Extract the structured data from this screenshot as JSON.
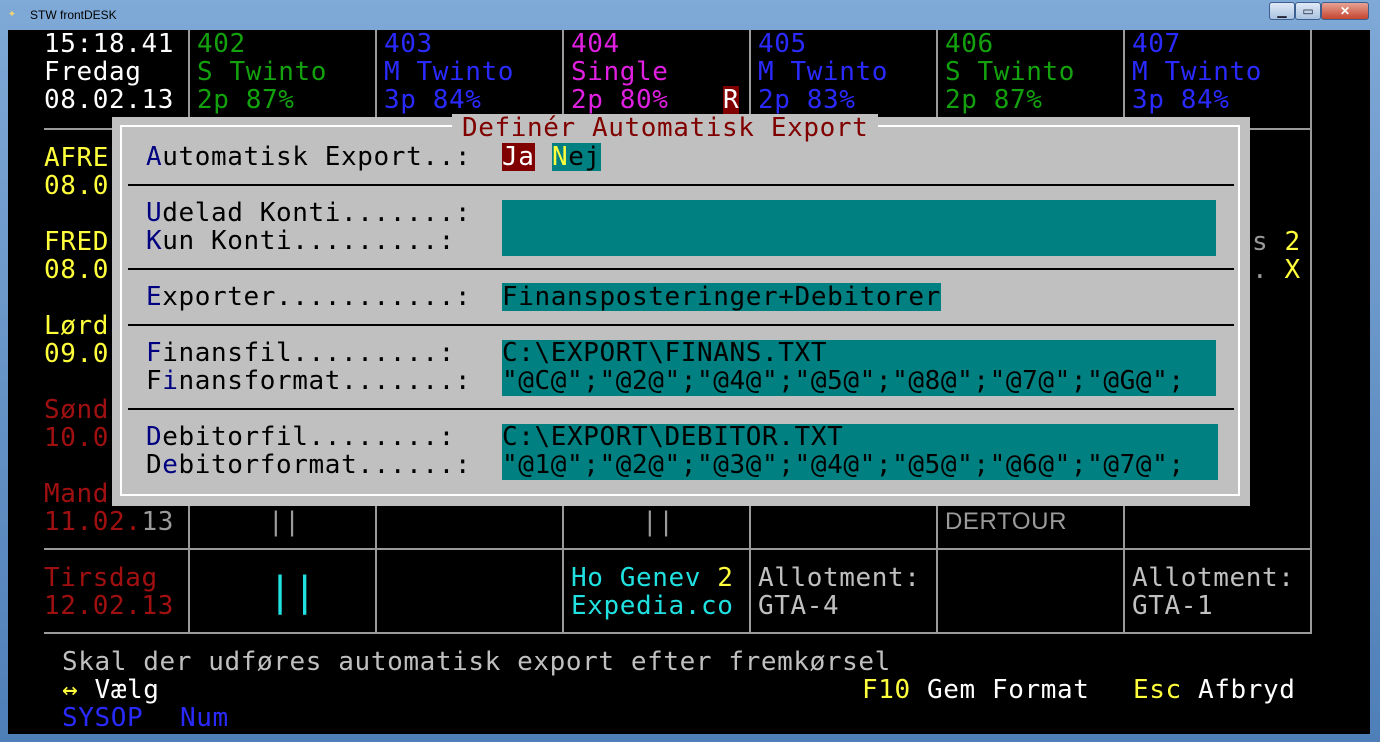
{
  "window": {
    "title": "STW frontDESK",
    "minimize": "▁",
    "restore": "▭",
    "close": "✕"
  },
  "clock": {
    "time": "15:18.41",
    "day": "Fredag",
    "date": "08.02.13"
  },
  "rooms": [
    {
      "number": "402",
      "type": "S Twinto",
      "stats": "2p 87%",
      "color": "#13a10e"
    },
    {
      "number": "403",
      "type": "M Twinto",
      "stats": "3p 84%",
      "color": "#2a2aff"
    },
    {
      "number": "404",
      "type": "Single",
      "stats": "2p 80%",
      "color": "#e020e0",
      "flag": "R"
    },
    {
      "number": "405",
      "type": "M Twinto",
      "stats": "2p 83%",
      "color": "#2a2aff"
    },
    {
      "number": "406",
      "type": "S Twinto",
      "stats": "2p 87%",
      "color": "#13a10e"
    },
    {
      "number": "407",
      "type": "M Twinto",
      "stats": "3p 84%",
      "color": "#2a2aff"
    }
  ],
  "days": [
    {
      "name": "AFRE",
      "date": "08.0"
    },
    {
      "name": "FRED",
      "date": "08.0"
    },
    {
      "name": "Lørd",
      "date": "09.0"
    },
    {
      "name": "Sønd",
      "date": "10.0"
    },
    {
      "name": "Mand",
      "date": "11.02.",
      "date_suffix": "13"
    },
    {
      "name": "Tirsdag",
      "date": "12.02.13"
    }
  ],
  "grid_fragments": {
    "right_row2_a": "s 2",
    "right_row2_b": ". X",
    "dertour": "DERTOUR",
    "bars_a": "||",
    "bars_b": "||",
    "bars_c": "||",
    "ho_genev": "Ho Genev",
    "ho_genev_n": "2",
    "expedia": "Expedia.co",
    "allot1_label": "Allotment:",
    "allot1_value": "GTA-4",
    "allot2_label": "Allotment:",
    "allot2_value": "GTA-1"
  },
  "dialog": {
    "title": "Definér Automatisk Export",
    "auto_export": {
      "hotkey": "A",
      "label": "utomatisk Export..: ",
      "opt_yes_key": "J",
      "opt_yes_rest": "a",
      "opt_no_key": "N",
      "opt_no_rest": "ej"
    },
    "udelad": {
      "hotkey": "U",
      "label": "delad Konti.......: ",
      "value": ""
    },
    "kun": {
      "hotkey": "K",
      "label": "un Konti.........: ",
      "value": ""
    },
    "exporter": {
      "hotkey": "E",
      "label": "xporter...........: ",
      "value": "Finansposteringer+Debitorer"
    },
    "finansfil": {
      "hotkey": "F",
      "label": "inansfil.........: ",
      "value": "C:\\EXPORT\\FINANS.TXT"
    },
    "finansformat": {
      "prefix": "F",
      "hotkey": "i",
      "label": "nansformat.......: ",
      "value": "\"@C@\";\"@2@\";\"@4@\";\"@5@\";\"@8@\";\"@7@\";\"@G@\";"
    },
    "debitorfil": {
      "hotkey": "D",
      "label": "ebitorfil........: ",
      "value": "C:\\EXPORT\\DEBITOR.TXT"
    },
    "debitorformat": {
      "prefix": "D",
      "hotkey": "e",
      "label": "bitorformat......: ",
      "value": "\"@1@\";\"@2@\";\"@3@\";\"@4@\";\"@5@\";\"@6@\";\"@7@\";"
    }
  },
  "status": {
    "message": "Skal der udføres automatisk export efter fremkørsel",
    "arrow_key": "↔",
    "arrow_label": "Vælg",
    "f10_key": "F10",
    "f10_label": "Gem Format",
    "esc_key": "Esc",
    "esc_label": "Afbryd",
    "user": "SYSOP",
    "num": "Num"
  }
}
